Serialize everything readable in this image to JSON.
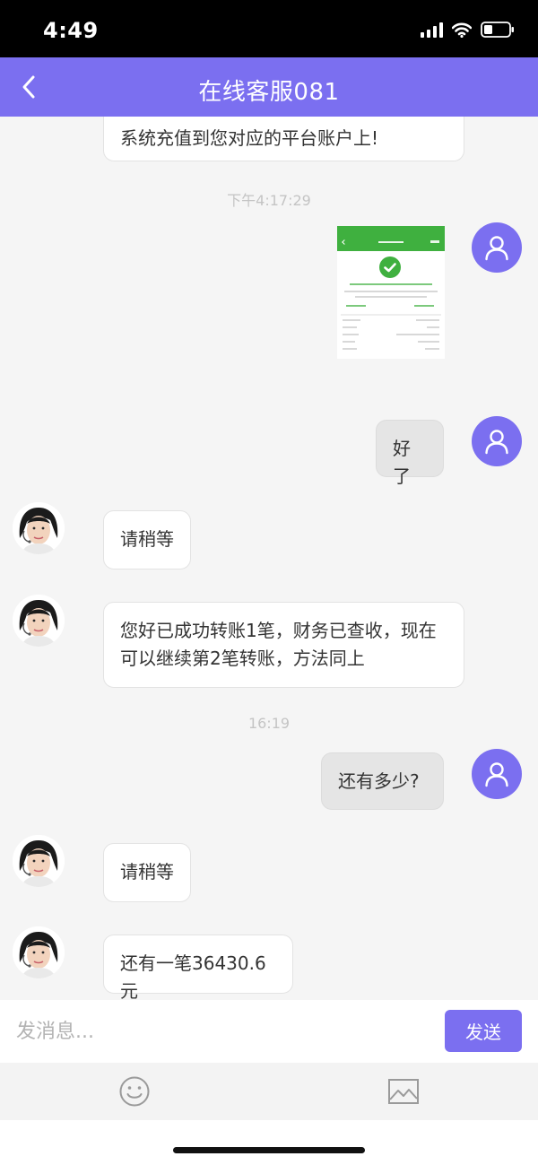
{
  "status_bar": {
    "time": "4:49"
  },
  "header": {
    "title": "在线客服081"
  },
  "messages": [
    {
      "sender": "agent",
      "text": "系统充值到您对应的平台账户上!"
    },
    {
      "type": "timestamp",
      "text": "下午4:17:29"
    },
    {
      "sender": "user",
      "type": "image",
      "content": "payment-receipt-screenshot"
    },
    {
      "sender": "user",
      "text": "好了"
    },
    {
      "sender": "agent",
      "text": "请稍等"
    },
    {
      "sender": "agent",
      "text": "您好已成功转账1笔，财务已查收，现在可以继续第2笔转账，方法同上"
    },
    {
      "type": "timestamp",
      "text": "16:19"
    },
    {
      "sender": "user",
      "text": "还有多少?"
    },
    {
      "sender": "agent",
      "text": "请稍等"
    },
    {
      "sender": "agent",
      "text": "还有一笔36430.6元"
    }
  ],
  "composer": {
    "placeholder": "发消息...",
    "send_label": "发送"
  },
  "toolbar": {
    "icons": [
      "emoji-icon",
      "image-icon"
    ]
  },
  "colors": {
    "accent": "#7b6ff0",
    "page_bg": "#f5f5f5",
    "user_bubble": "#e5e5e5",
    "agent_bubble": "#ffffff",
    "timestamp": "#c4c4c4"
  }
}
